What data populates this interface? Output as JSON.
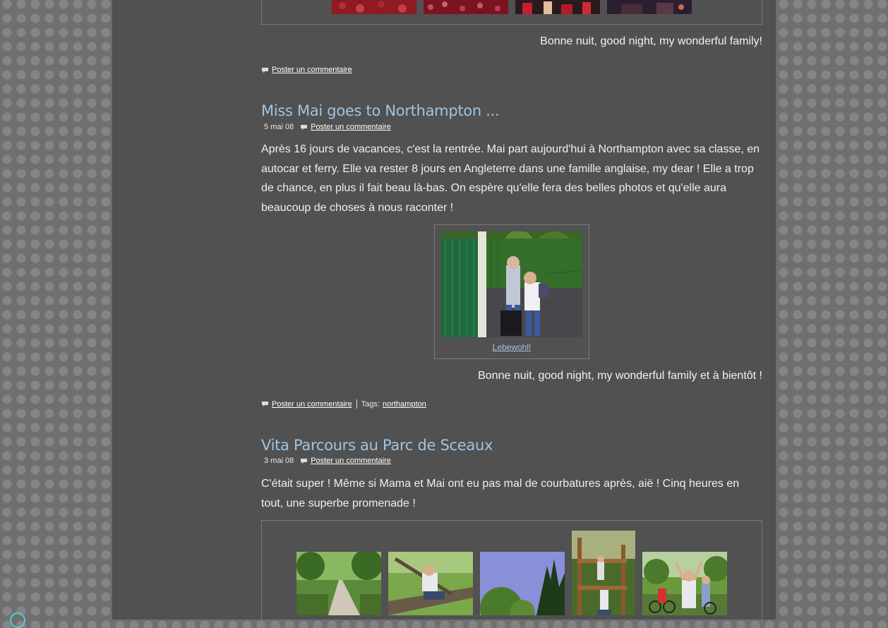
{
  "post_top": {
    "signoff": "Bonne nuit, good night, my wonderful family!",
    "comment_link": "Poster un commentaire"
  },
  "post_northampton": {
    "title": "Miss Mai goes to Northampton ...",
    "date": "5 mai 08",
    "meta_comment_link": "Poster un commentaire",
    "body": "Après 16 jours de vacances, c'est la rentrée. Mai part aujourd'hui à Northampton avec sa classe, en autocar et ferry. Elle va rester 8 jours en Angleterre dans une famille anglaise, my dear ! Elle a trop de chance, en plus il fait beau là-bas. On espère qu'elle fera des belles photos et qu'elle aura beaucoup de choses à nous raconter !",
    "photo_caption": "Lebewohl!",
    "signoff": "Bonne nuit, good night, my wonderful family et à bientôt !",
    "footer_comment_link": "Poster un commentaire",
    "tags_label": "Tags:",
    "tag": "northampton"
  },
  "post_sceaux": {
    "title": "Vita Parcours au Parc de Sceaux",
    "date": "3 mai 08",
    "meta_comment_link": "Poster un commentaire",
    "body": "C'était super ! Même si Mama et Mai ont eu pas mal de courbatures après, aiё ! Cinq heures en tout, une superbe promenade !"
  },
  "colors": {
    "page_bg": "#515151",
    "outer_bg": "#6f6f6f",
    "title": "#9ec4e2",
    "link": "#ffffff",
    "caption_link": "#9ec4e2"
  }
}
